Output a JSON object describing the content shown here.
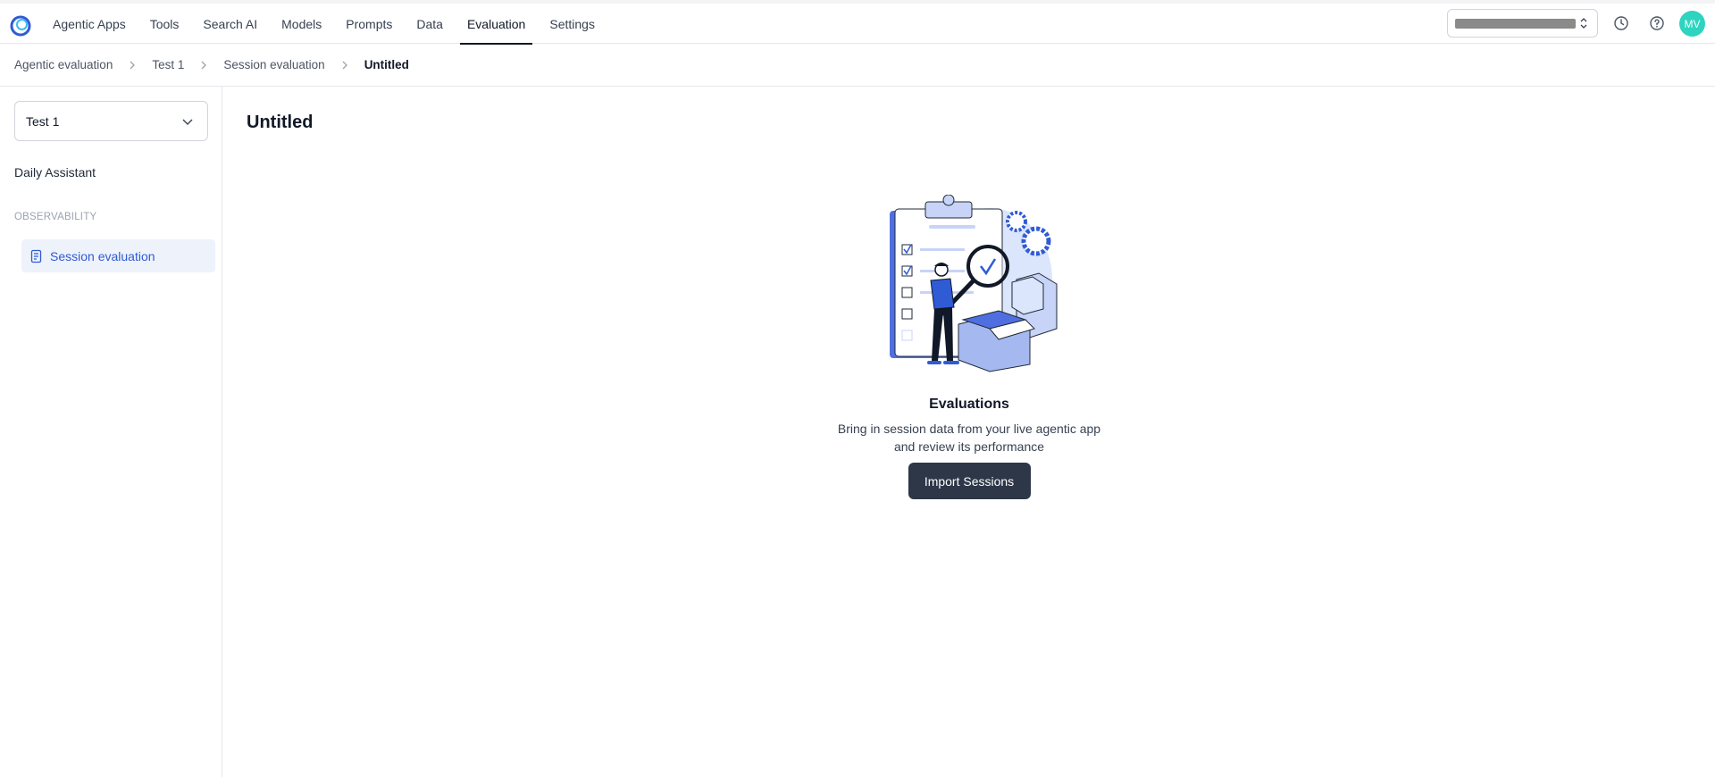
{
  "nav": {
    "items": [
      "Agentic Apps",
      "Tools",
      "Search AI",
      "Models",
      "Prompts",
      "Data",
      "Evaluation",
      "Settings"
    ],
    "active": "Evaluation"
  },
  "header": {
    "avatar_initials": "MV",
    "avatar_color": "#2dd4bf"
  },
  "breadcrumb": {
    "items": [
      "Agentic evaluation",
      "Test 1",
      "Session evaluation",
      "Untitled"
    ]
  },
  "sidebar": {
    "project": "Test 1",
    "app_name": "Daily Assistant",
    "section_label": "OBSERVABILITY",
    "items": [
      {
        "label": "Session evaluation",
        "active": true
      }
    ]
  },
  "main": {
    "title": "Untitled",
    "empty_state": {
      "title": "Evaluations",
      "description_line1": "Bring in session data from your live agentic app",
      "description_line2": "and review its performance",
      "button_label": "Import Sessions"
    }
  },
  "colors": {
    "accent": "#2f5bd4",
    "button_bg": "#2d3748",
    "active_item_bg": "#eef2fb"
  }
}
